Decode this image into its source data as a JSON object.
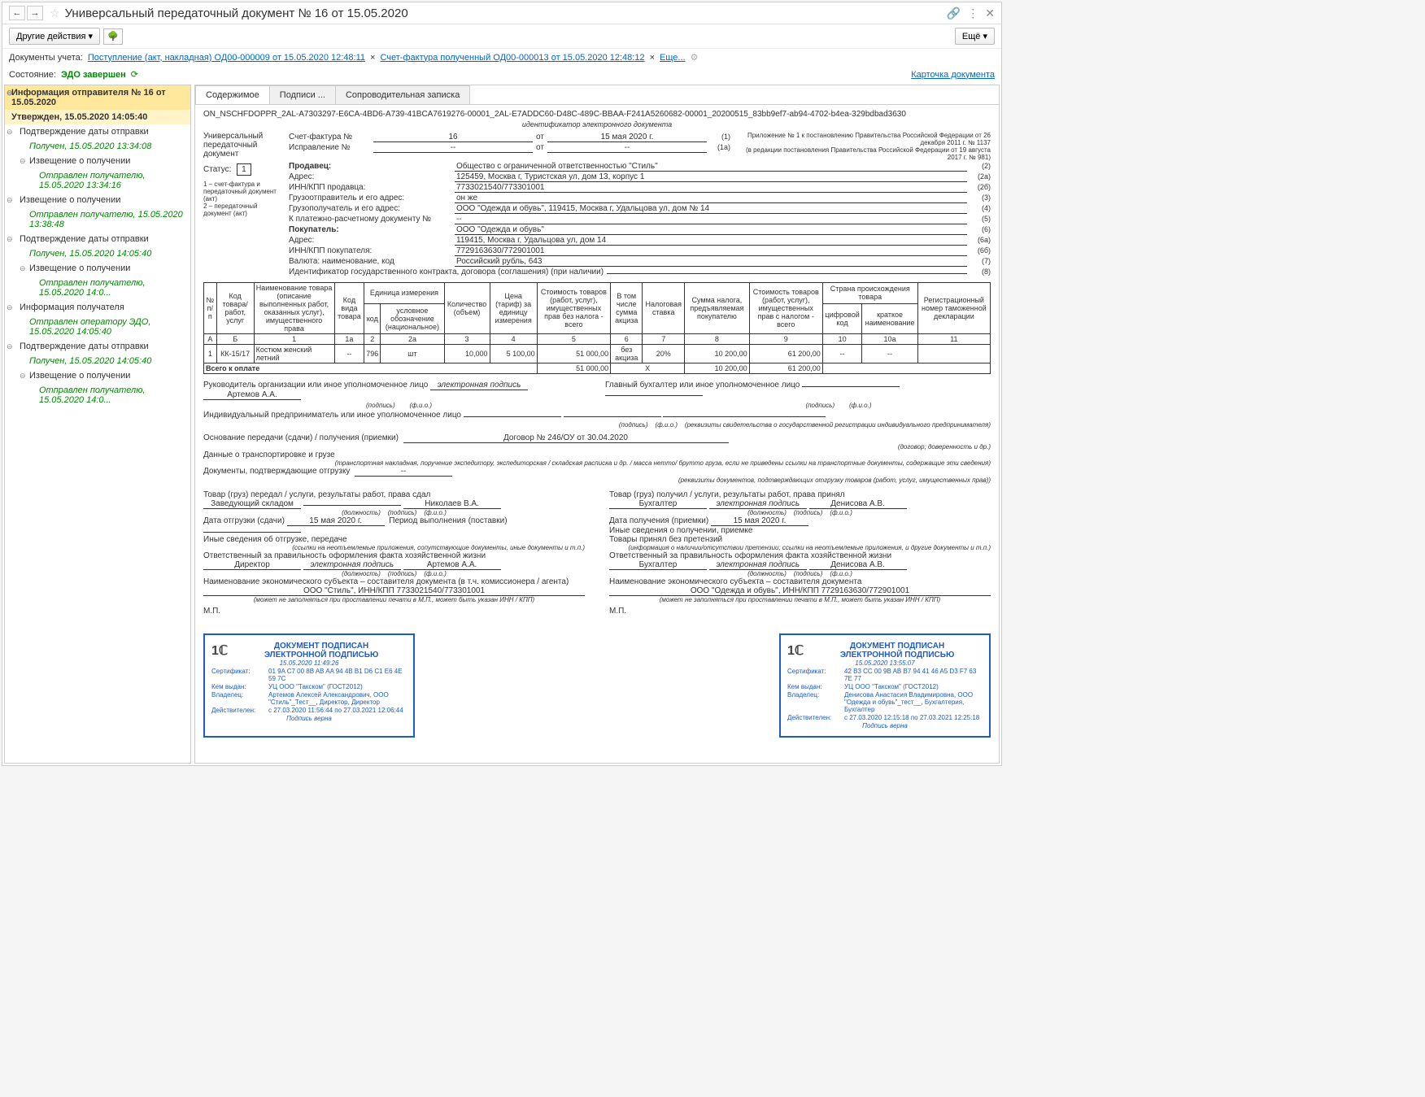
{
  "header": {
    "title": "Универсальный передаточный документ № 16 от 15.05.2020",
    "other_actions": "Другие действия",
    "more": "Ещё"
  },
  "doclinks": {
    "label": "Документы учета:",
    "link1": "Поступление (акт, накладная) ОД00-000009 от 15.05.2020 12:48:11",
    "link2": "Счет-фактура полученный ОД00-000013 от 15.05.2020 12:48:12",
    "more": "Еще...",
    "card": "Карточка документа"
  },
  "status": {
    "label": "Состояние:",
    "value": "ЭДО завершен"
  },
  "tree": {
    "n0": "Информация отправителя № 16 от 15.05.2020",
    "n0b": "Утвержден, 15.05.2020 14:05:40",
    "n1": "Подтверждение даты отправки",
    "n1a": "Получен, 15.05.2020 13:34:08",
    "n1b": "Извещение о получении",
    "n1c": "Отправлен получателю, 15.05.2020 13:34:16",
    "n2": "Извещение о получении",
    "n2a": "Отправлен получателю, 15.05.2020 13:38:48",
    "n3": "Подтверждение даты отправки",
    "n3a": "Получен, 15.05.2020 14:05:40",
    "n3b": "Извещение о получении",
    "n3c": "Отправлен получателю, 15.05.2020 14:0...",
    "n4": "Информация получателя",
    "n4a": "Отправлен оператору ЭДО, 15.05.2020 14:05:40",
    "n5": "Подтверждение даты отправки",
    "n5a": "Получен, 15.05.2020 14:05:40",
    "n5b": "Извещение о получении",
    "n5c": "Отправлен получателю, 15.05.2020 14:0..."
  },
  "tabs": {
    "t1": "Содержимое",
    "t2": "Подписи ...",
    "t3": "Сопроводительная записка"
  },
  "doc": {
    "id": "ON_NSCHFDOPPR_2AL-A7303297-E6CA-4BD6-A739-41BCA7619276-00001_2AL-E7ADDC60-D48C-489C-BBAA-F241A5260682-00001_20200515_83bb9ef7-ab94-4702-b4ea-329bdbad3630",
    "id_caption": "идентификатор электронного документа",
    "left1": "Универсальный передаточный документ",
    "status_label": "Статус:",
    "status_val": "1",
    "left_note": "1 – счет-фактура и передаточный документ (акт)\n2 – передаточный документ (акт)",
    "note_right": "Приложение № 1 к постановлению Правительства Российской Федерации от 26 декабря 2011 г. № 1137\n(в редакции постановления Правительства Российской Федерации от 19 августа 2017 г. № 981)",
    "r1a": "Счет-фактура №",
    "r1b": "16",
    "r1c": "от",
    "r1d": "15 мая 2020 г.",
    "r1n": "(1)",
    "r2a": "Исправление №",
    "r2b": "--",
    "r2c": "от",
    "r2d": "--",
    "r2n": "(1а)",
    "r3a": "Продавец:",
    "r3b": "Общество с ограниченной ответственностью \"Стиль\"",
    "r3n": "(2)",
    "r4a": "Адрес:",
    "r4b": "125459, Москва г, Туристская ул, дом 13, корпус 1",
    "r4n": "(2а)",
    "r5a": "ИНН/КПП продавца:",
    "r5b": "7733021540/773301001",
    "r5n": "(2б)",
    "r6a": "Грузоотправитель и его адрес:",
    "r6b": "он же",
    "r6n": "(3)",
    "r7a": "Грузополучатель и его адрес:",
    "r7b": "ООО \"Одежда и обувь\", 119415, Москва г, Удальцова ул, дом № 14",
    "r7n": "(4)",
    "r8a": "К платежно-расчетному документу №",
    "r8b": "--",
    "r8n": "(5)",
    "r9a": "Покупатель:",
    "r9b": "ООО \"Одежда и обувь\"",
    "r9n": "(6)",
    "r10a": "Адрес:",
    "r10b": "119415, Москва г, Удальцова ул, дом 14",
    "r10n": "(6а)",
    "r11a": "ИНН/КПП покупателя:",
    "r11b": "7729163630/772901001",
    "r11n": "(6б)",
    "r12a": "Валюта: наименование, код",
    "r12b": "Российский рубль, 643",
    "r12n": "(7)",
    "r13a": "Идентификатор государственного контракта, договора (соглашения) (при наличии)",
    "r13b": "",
    "r13n": "(8)"
  },
  "table": {
    "h1": "№ п/п",
    "h2": "Код товара/ работ, услуг",
    "h3": "Наименование товара (описание выполненных работ, оказанных услуг), имущественного права",
    "h4": "Код вида товара",
    "h5": "Единица измерения",
    "h5a": "код",
    "h5b": "условное обозначение (национальное)",
    "h6": "Количество (объем)",
    "h7": "Цена (тариф) за единицу измерения",
    "h8": "Стоимость товаров (работ, услуг), имущественных прав без налога - всего",
    "h9": "В том числе сумма акциза",
    "h10": "Налоговая ставка",
    "h11": "Сумма налога, предъявляемая покупателю",
    "h12": "Стоимость товаров (работ, услуг), имущественных прав с налогом - всего",
    "h13": "Страна происхождения товара",
    "h13a": "цифровой код",
    "h13b": "краткое наименование",
    "h14": "Регистрационный номер таможенной декларации",
    "cA": "А",
    "cB": "Б",
    "c1": "1",
    "c1a": "1а",
    "c2": "2",
    "c2a": "2а",
    "c3": "3",
    "c4": "4",
    "c5": "5",
    "c6": "6",
    "c7": "7",
    "c8": "8",
    "c9": "9",
    "c10": "10",
    "c10a": "10а",
    "c11": "11",
    "row1": {
      "n": "1",
      "code": "КК-15/17",
      "name": "Костюм женский летний",
      "kind": "--",
      "ucod": "796",
      "uname": "шт",
      "qty": "10,000",
      "price": "5 100,00",
      "sum": "51 000,00",
      "excise": "без акциза",
      "rate": "20%",
      "tax": "10 200,00",
      "total": "61 200,00",
      "country": "--",
      "countryname": "--",
      "decl": ""
    },
    "total_label": "Всего к оплате",
    "total_sum": "51 000,00",
    "total_x": "Х",
    "total_tax": "10 200,00",
    "total_all": "61 200,00"
  },
  "sig": {
    "s1": "Руководитель организации или иное уполномоченное лицо",
    "s1v": "электронная подпись",
    "s1p": "Артемов А.А.",
    "s2": "Главный бухгалтер или иное уполномоченное лицо",
    "s3": "Индивидуальный предприниматель или иное уполномоченное лицо",
    "cap_sign": "(подпись)",
    "cap_fio": "(ф.и.о.)",
    "cap_rekv": "(реквизиты свидетельства о государственной регистрации индивидуального предпринимателя)",
    "basis_label": "Основание передачи (сдачи) / получения (приемки)",
    "basis_val": "Договор № 246/ОУ от 30.04.2020",
    "basis_cap": "(договор; доверенность и др.)",
    "trans_label": "Данные о транспортировке и грузе",
    "trans_cap": "(транспортная накладная, поручение экспедитору, экспедиторская / складская расписка и др. / масса нетто/ брутто груза, если не приведены ссылки на транспортные документы, содержащие эти сведения)",
    "ship_label": "Документы, подтверждающие отгрузку",
    "ship_val": "--",
    "ship_cap": "(реквизиты документов, подтверждающих отгрузку товаров (работ, услуг, имущественных прав))",
    "left_title": "Товар (груз) передал / услуги, результаты работ, права сдал",
    "left_pos": "Заведующий складом",
    "left_name": "Николаев В.А.",
    "left_date_label": "Дата отгрузки (сдачи)",
    "left_date": "15 мая 2020 г.",
    "left_period": "Период выполнения (поставки)",
    "left_other": "Иные сведения об отгрузке, передаче",
    "left_other_cap": "(ссылки на неотъемлемые приложения, сопутствующие документы, иные документы и т.п.)",
    "left_resp": "Ответственный за правильность оформления факта хозяйственной жизни",
    "left_resp_pos": "Директор",
    "left_resp_sig": "электронная подпись",
    "left_resp_name": "Артемов А.А.",
    "left_org_label": "Наименование экономического субъекта – составителя документа (в т.ч. комиссионера / агента)",
    "left_org": "ООО \"Стиль\", ИНН/КПП 7733021540/773301001",
    "left_org_cap": "(может не заполняться при проставлении печати в М.П., может быть указан ИНН / КПП)",
    "mp": "М.П.",
    "right_title": "Товар (груз) получил / услуги, результаты работ, права принял",
    "right_pos": "Бухгалтер",
    "right_sig": "электронная подпись",
    "right_name": "Денисова А.В.",
    "right_date_label": "Дата получения (приемки)",
    "right_date": "15 мая 2020 г.",
    "right_other": "Иные сведения о получении, приемке",
    "right_claim": "Товары принял без претензий",
    "right_other_cap": "(информация о наличии/отсутствии претензии; ссылки на неотъемлемые приложения, и другие документы и т.п.)",
    "right_resp": "Ответственный за правильность оформления факта хозяйственной жизни",
    "right_resp_pos": "Бухгалтер",
    "right_resp_sig": "электронная подпись",
    "right_resp_name": "Денисова А.В.",
    "right_org_label": "Наименование экономического субъекта – составителя документа",
    "right_org": "ООО \"Одежда и обувь\", ИНН/КПП 7729163630/772901001",
    "cap_pos": "(должность)"
  },
  "stamp1": {
    "title1": "ДОКУМЕНТ ПОДПИСАН",
    "title2": "ЭЛЕКТРОННОЙ ПОДПИСЬЮ",
    "date": "15.05.2020 11:49:26",
    "cert_l": "Сертификат:",
    "cert": "01 9A C7 00 8B AB AA 94 4B B1 D6 C1 E6 4E 59 7C",
    "issuer_l": "Кем выдан:",
    "issuer": "УЦ ООО \"Такском\" (ГОСТ2012)",
    "owner_l": "Владелец:",
    "owner": "Артемов Алексей Александрович, ООО \"Стиль\"_Тест__, Директор, Директор",
    "valid_l": "Действителен:",
    "valid": "с 27.03.2020 11:56:44 по 27.03.2021 12:06:44",
    "ok": "Подпись верна"
  },
  "stamp2": {
    "title1": "ДОКУМЕНТ ПОДПИСАН",
    "title2": "ЭЛЕКТРОННОЙ ПОДПИСЬЮ",
    "date": "15.05.2020 13:55:07",
    "cert_l": "Сертификат:",
    "cert": "42 B3 CC 00 9B AB B7 94 41 46 A5 D3 F7 63 7E 77",
    "issuer_l": "Кем выдан:",
    "issuer": "УЦ ООО \"Такском\" (ГОСТ2012)",
    "owner_l": "Владелец:",
    "owner": "Денисова Анастасия Владимировна, ООО \"Одежда и обувь\"_тест__, Бухгалтерия, Бухгалтер",
    "valid_l": "Действителен:",
    "valid": "с 27.03.2020 12:15:18 по 27.03.2021 12:25:18",
    "ok": "Подпись верна"
  }
}
